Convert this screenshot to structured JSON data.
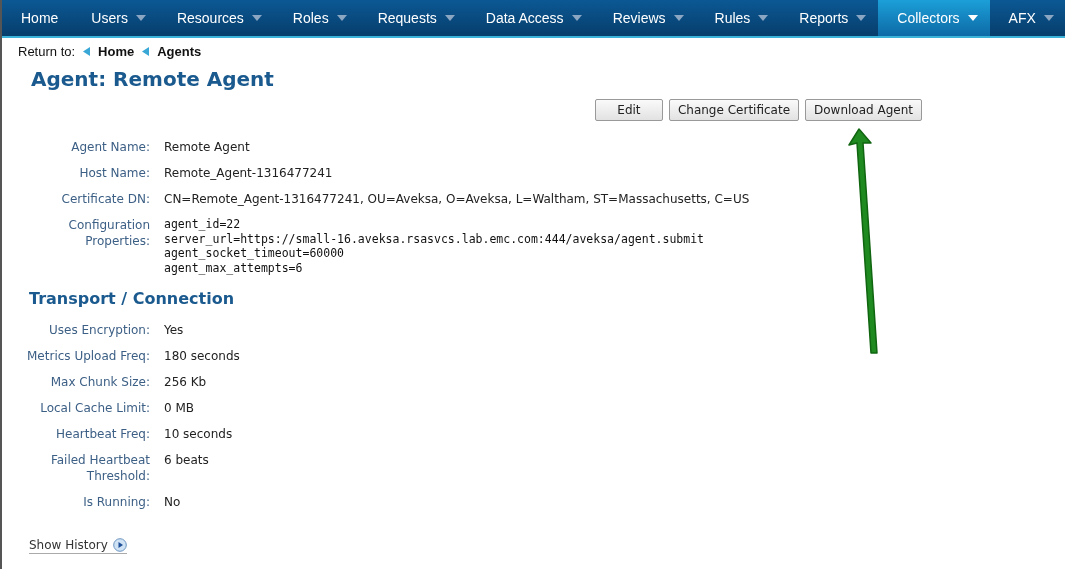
{
  "nav": [
    {
      "label": "Home",
      "dropdown": false,
      "selected": false
    },
    {
      "label": "Users",
      "dropdown": true,
      "selected": false
    },
    {
      "label": "Resources",
      "dropdown": true,
      "selected": false
    },
    {
      "label": "Roles",
      "dropdown": true,
      "selected": false
    },
    {
      "label": "Requests",
      "dropdown": true,
      "selected": false
    },
    {
      "label": "Data Access",
      "dropdown": true,
      "selected": false
    },
    {
      "label": "Reviews",
      "dropdown": true,
      "selected": false
    },
    {
      "label": "Rules",
      "dropdown": true,
      "selected": false
    },
    {
      "label": "Reports",
      "dropdown": true,
      "selected": false
    },
    {
      "label": "Collectors",
      "dropdown": true,
      "selected": true
    },
    {
      "label": "AFX",
      "dropdown": true,
      "selected": false
    }
  ],
  "breadcrumb": {
    "label": "Return to:",
    "links": [
      "Home",
      "Agents"
    ]
  },
  "title": "Agent: Remote Agent",
  "buttons": [
    "Edit",
    "Change Certificate",
    "Download Agent"
  ],
  "details": [
    {
      "label": "Agent Name:",
      "value": "Remote Agent",
      "kind": "text"
    },
    {
      "label": "Host Name:",
      "value": "Remote_Agent-1316477241",
      "kind": "text"
    },
    {
      "label": "Certificate DN:",
      "value": "CN=Remote_Agent-1316477241, OU=Aveksa, O=Aveksa, L=Waltham, ST=Massachusetts, C=US",
      "kind": "text"
    },
    {
      "label": "Configuration Properties:",
      "lines": [
        "agent_id=22",
        "server_url=https://small-16.aveksa.rsasvcs.lab.emc.com:444/aveksa/agent.submit",
        "agent_socket_timeout=60000",
        "agent_max_attempts=6"
      ],
      "kind": "code"
    }
  ],
  "transport": {
    "title": "Transport / Connection",
    "rows": [
      {
        "label": "Uses Encryption:",
        "value": "Yes"
      },
      {
        "label": "Metrics Upload Freq:",
        "value": "180 seconds"
      },
      {
        "label": "Max Chunk Size:",
        "value": "256 Kb"
      },
      {
        "label": "Local Cache Limit:",
        "value": "0 MB"
      },
      {
        "label": "Heartbeat Freq:",
        "value": "10 seconds"
      },
      {
        "label": "Failed Heartbeat Threshold:",
        "value": "6 beats"
      },
      {
        "label": "Is Running:",
        "value": "No"
      }
    ]
  },
  "show_history": "Show History"
}
